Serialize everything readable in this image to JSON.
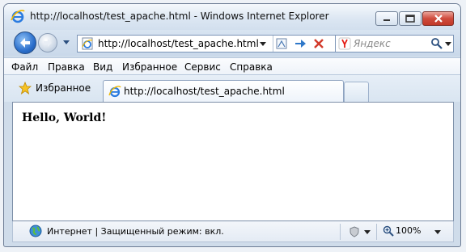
{
  "window": {
    "title": "http://localhost/test_apache.html - Windows Internet Explorer"
  },
  "address": {
    "url": "http://localhost/test_apache.html"
  },
  "search": {
    "placeholder": "Яндекс"
  },
  "menu": {
    "items": [
      "Файл",
      "Правка",
      "Вид",
      "Избранное",
      "Сервис",
      "Справка"
    ]
  },
  "favorites": {
    "label": "Избранное"
  },
  "tab": {
    "title": "http://localhost/test_apache.html"
  },
  "page": {
    "heading": "Hello, World!"
  },
  "status": {
    "text": "Интернет | Защищенный режим: вкл.",
    "zoom": "100%"
  },
  "colors": {
    "close_button": "#cf4b3d",
    "nav_back": "#2b6fcc"
  }
}
